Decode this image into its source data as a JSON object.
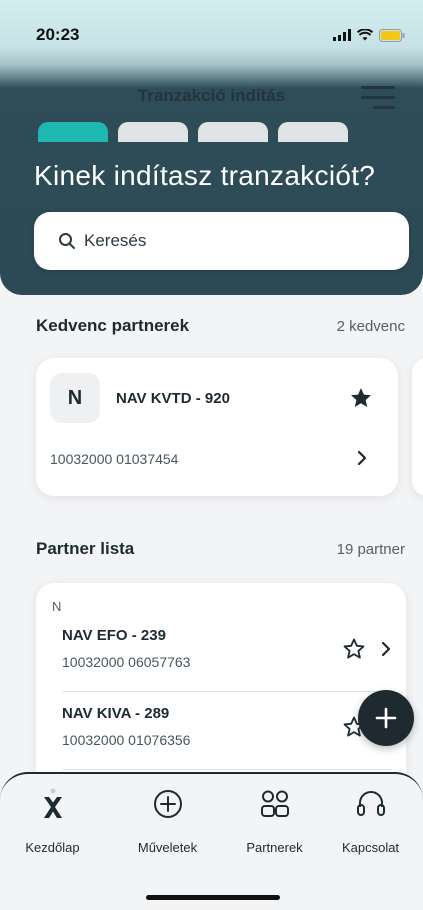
{
  "status_bar": {
    "time": "20:23",
    "icons": [
      "signal-icon",
      "wifi-icon",
      "battery-icon"
    ],
    "battery_color": "#f5c518"
  },
  "header": {
    "title": "Tranzakció indítás",
    "menu_icon": "hamburger-menu-icon",
    "steps": 4,
    "active_step": 1,
    "headline": "Kinek indítasz tranzakciót?"
  },
  "search": {
    "icon": "search-icon",
    "placeholder": "Keresés"
  },
  "favorites": {
    "title": "Kedvenc partnerek",
    "count_label": "2 kedvenc",
    "items": [
      {
        "initial": "N",
        "name": "NAV KVTD - 920",
        "account": "10032000 01037454",
        "starred": true
      }
    ]
  },
  "partners": {
    "title": "Partner lista",
    "count_label": "19 partner",
    "group_letter": "N",
    "items": [
      {
        "name": "NAV EFO - 239",
        "account": "10032000 06057763",
        "starred": false
      },
      {
        "name": "NAV KIVA - 289",
        "account": "10032000 01076356",
        "starred": false
      }
    ]
  },
  "fab": {
    "icon": "plus-icon"
  },
  "bottom_nav": {
    "items": [
      {
        "label": "Kezdőlap",
        "icon": "home-x-logo-icon"
      },
      {
        "label": "Műveletek",
        "icon": "plus-circle-icon"
      },
      {
        "label": "Partnerek",
        "icon": "partners-icon"
      },
      {
        "label": "Kapcsolat",
        "icon": "headset-icon"
      }
    ]
  },
  "colors": {
    "accent": "#1fb8b0",
    "header_dark": "#2c4a55",
    "text_dark": "#1f2a30"
  }
}
